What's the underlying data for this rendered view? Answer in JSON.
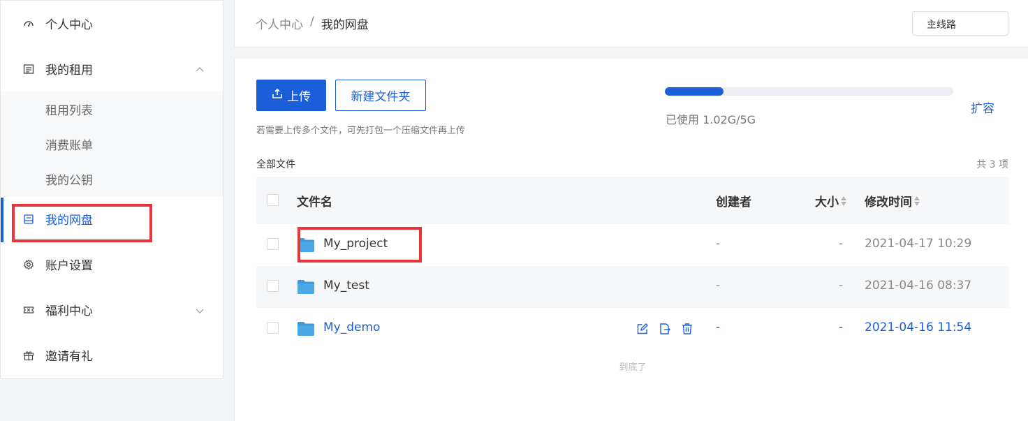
{
  "sidebar": {
    "items": [
      {
        "label": "个人中心",
        "icon": "dashboard-icon"
      },
      {
        "label": "我的租用",
        "icon": "server-icon",
        "expanded": true
      },
      {
        "label": "我的网盘",
        "icon": "disk-icon",
        "active": true
      },
      {
        "label": "账户设置",
        "icon": "gear-icon"
      },
      {
        "label": "福利中心",
        "icon": "ticket-icon"
      },
      {
        "label": "邀请有礼",
        "icon": "gift-icon"
      }
    ],
    "submenu": [
      "租用列表",
      "消费账单",
      "我的公钥"
    ]
  },
  "header": {
    "breadcrumb": [
      "个人中心",
      "/",
      "我的网盘"
    ],
    "route_select": "主线路"
  },
  "toolbar": {
    "upload_label": "上传",
    "new_folder_label": "新建文件夹",
    "hint": "若需要上传多个文件，可先打包一个压缩文件再上传"
  },
  "storage": {
    "usage_text": "已使用 1.02G/5G",
    "used_fraction": 0.204,
    "expand_label": "扩容"
  },
  "files": {
    "title": "全部文件",
    "total": "共 3 项",
    "columns": {
      "name": "文件名",
      "creator": "创建者",
      "size": "大小",
      "mtime": "修改时间"
    },
    "rows": [
      {
        "name": "My_project",
        "creator": "-",
        "size": "-",
        "mtime": "2021-04-17 10:29"
      },
      {
        "name": "My_test",
        "creator": "-",
        "size": "-",
        "mtime": "2021-04-16 08:37"
      },
      {
        "name": "My_demo",
        "creator": "-",
        "size": "-",
        "mtime": "2021-04-16 11:54"
      }
    ],
    "end_text": "到底了"
  },
  "colors": {
    "accent": "#1a5fd9",
    "folder": "#3d9bdc",
    "highlight": "#e8353b"
  }
}
